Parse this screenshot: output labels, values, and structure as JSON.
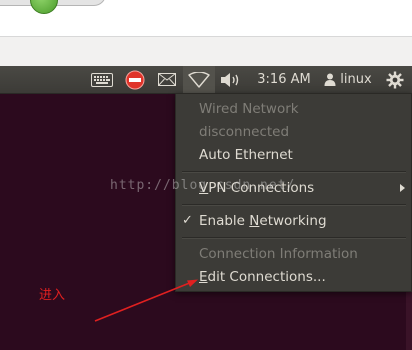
{
  "panel": {
    "indicators": {
      "keyboard": "keyboard-icon",
      "stop": "stop-icon",
      "mail": "mail-icon",
      "network": "wifi-icon",
      "volume": "volume-icon",
      "session": "gear-icon"
    },
    "clock": "3:16 AM",
    "user": "linux"
  },
  "network_menu": {
    "wired_header": "Wired Network",
    "wired_status": "disconnected",
    "auto_ethernet": "Auto Ethernet",
    "vpn_prefix": "",
    "vpn_accel": "V",
    "vpn_rest": "PN Connections",
    "enable_prefix": "Enable ",
    "enable_accel": "N",
    "enable_rest": "etworking",
    "enable_checked": "✓",
    "connection_info": "Connection Information",
    "edit_prefix": "",
    "edit_accel": "E",
    "edit_rest": "dit Connections..."
  },
  "watermark": "http://blog.csdn.net/",
  "annotation": {
    "label": "进入",
    "color": "#e02020"
  },
  "colors": {
    "panel_bg": "#3c3b37",
    "desktop_bg": "#2c0a1e",
    "menu_text": "#dfdbd2",
    "menu_disabled": "#7f7d77"
  }
}
